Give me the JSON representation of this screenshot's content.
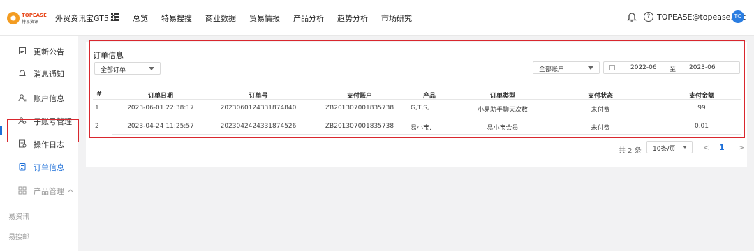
{
  "header": {
    "logo_text_top": "TOPEASE",
    "logo_text_bottom": "特易资讯",
    "app_name": "外贸资讯宝GT5.0",
    "nav": [
      "总览",
      "特易搜搜",
      "商业数据",
      "贸易情报",
      "产品分析",
      "趋势分析",
      "市场研究"
    ],
    "user_email": "TOPEASE@topease.net",
    "avatar_initials": "TO"
  },
  "sidebar": {
    "items": [
      {
        "label": "更新公告",
        "icon": "announcement-icon"
      },
      {
        "label": "消息通知",
        "icon": "bell-icon"
      },
      {
        "label": "账户信息",
        "icon": "user-icon"
      },
      {
        "label": "子账号管理",
        "icon": "users-icon"
      },
      {
        "label": "操作日志",
        "icon": "log-icon"
      },
      {
        "label": "订单信息",
        "icon": "order-icon"
      },
      {
        "label": "产品管理",
        "icon": "grid-icon"
      }
    ],
    "active_index": 5,
    "sub_items": [
      "易资讯",
      "易搜邮"
    ]
  },
  "main": {
    "title": "订单信息",
    "order_filter": "全部订单",
    "account_filter": "全部账户",
    "date_from": "2022-06",
    "date_sep": "至",
    "date_to": "2023-06",
    "columns": [
      "#",
      "订单日期",
      "订单号",
      "支付账户",
      "产品",
      "订单类型",
      "支付状态",
      "支付金额"
    ],
    "rows": [
      [
        "1",
        "2023-06-01 22:38:17",
        "2023060124331874840",
        "ZB201307001835738",
        "G,T,S,",
        "小易助手聊天次数",
        "未付费",
        "99"
      ],
      [
        "2",
        "2023-04-24 11:25:57",
        "2023042424331874526",
        "ZB201307001835738",
        "易小宝,",
        "易小宝会员",
        "未付费",
        "0.01"
      ]
    ]
  },
  "pagination": {
    "total": "共 2 条",
    "page_size": "10条/页",
    "prev": "<",
    "current": "1",
    "next": ">"
  },
  "colors": {
    "accent": "#1d6fd8",
    "highlight": "#d9272e",
    "brand": "#f39c21"
  }
}
